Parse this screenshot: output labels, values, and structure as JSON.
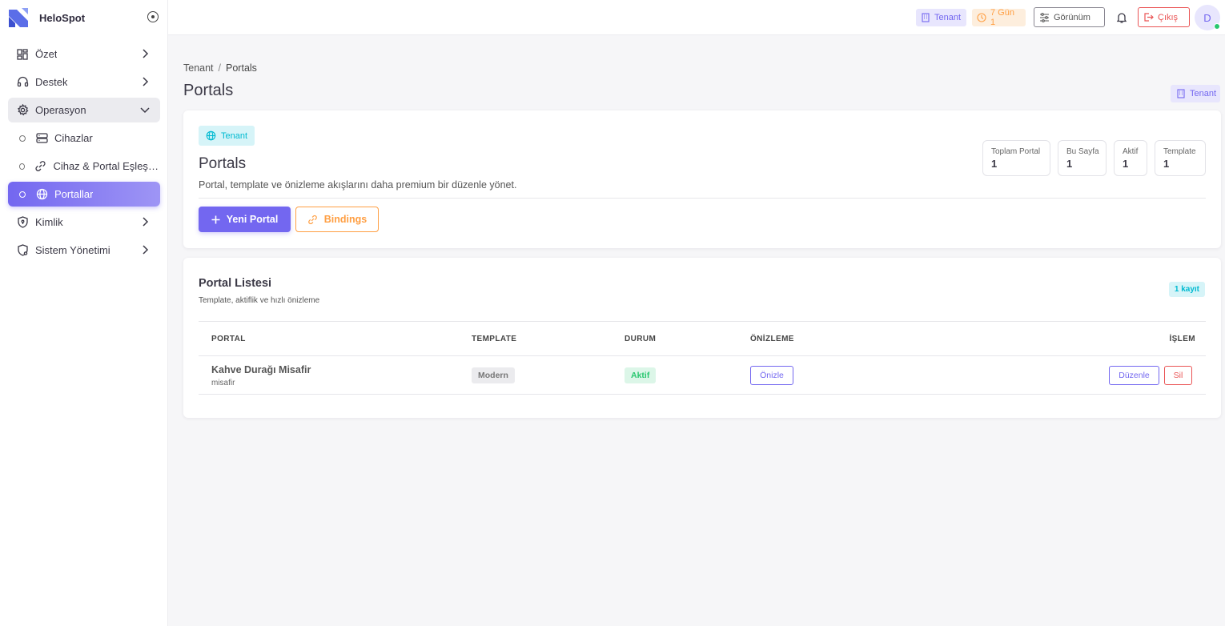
{
  "app": {
    "name": "HeloSpot"
  },
  "sidebar": {
    "items": [
      {
        "label": "Özet",
        "icon": "dashboard-icon"
      },
      {
        "label": "Destek",
        "icon": "headset-icon"
      },
      {
        "label": "Operasyon",
        "icon": "settings-icon",
        "expanded": true
      },
      {
        "label": "Cihazlar",
        "icon": "server-icon"
      },
      {
        "label": "Cihaz & Portal Eşleştirme",
        "icon": "link-icon"
      },
      {
        "label": "Portallar",
        "icon": "globe-icon",
        "active": true
      },
      {
        "label": "Kimlik",
        "icon": "shield-icon"
      },
      {
        "label": "Sistem Yönetimi",
        "icon": "system-settings-icon"
      }
    ]
  },
  "topbar": {
    "tenant": "Tenant",
    "days": "7 Gün 1",
    "view": "Görünüm",
    "logout": "Çıkış",
    "avatar": "D"
  },
  "breadcrumb": {
    "root": "Tenant",
    "sep": "/",
    "current": "Portals"
  },
  "page": {
    "title": "Portals",
    "scope_badge": "Tenant"
  },
  "hero": {
    "tag": "Tenant",
    "title": "Portals",
    "subtitle": "Portal, template ve önizleme akışlarını daha premium bir düzenle yönet.",
    "new_button": "Yeni Portal",
    "bindings_button": "Bindings",
    "stats": [
      {
        "label": "Toplam Portal",
        "value": "1"
      },
      {
        "label": "Bu Sayfa",
        "value": "1"
      },
      {
        "label": "Aktif",
        "value": "1"
      },
      {
        "label": "Template",
        "value": "1"
      }
    ]
  },
  "list": {
    "title": "Portal Listesi",
    "subtitle": "Template, aktiflik ve hızlı önizleme",
    "count": "1 kayıt",
    "columns": [
      "PORTAL",
      "TEMPLATE",
      "DURUM",
      "ÖNİZLEME",
      "İŞLEM"
    ],
    "rows": [
      {
        "name": "Kahve Durağı Misafir",
        "slug": "misafir",
        "template": "Modern",
        "status": "Aktif",
        "preview": "Önizle",
        "edit": "Düzenle",
        "delete": "Sil"
      }
    ]
  },
  "colors": {
    "primary": "#7367f0",
    "warning": "#ff9f43",
    "danger": "#ea5455",
    "success": "#28c76f",
    "info": "#00bad1"
  }
}
